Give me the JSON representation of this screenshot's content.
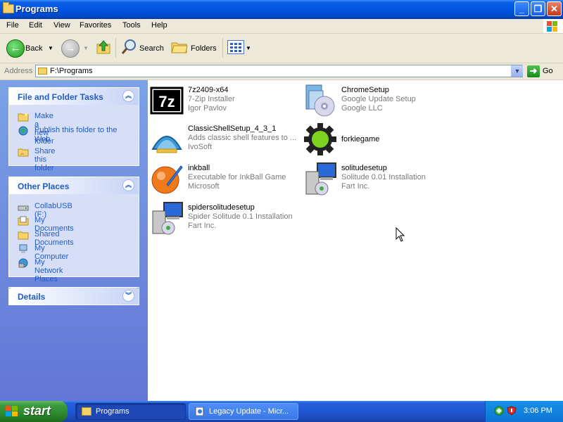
{
  "window": {
    "title": "Programs"
  },
  "menu": {
    "file": "File",
    "edit": "Edit",
    "view": "View",
    "favorites": "Favorites",
    "tools": "Tools",
    "help": "Help"
  },
  "toolbar": {
    "back": "Back",
    "search": "Search",
    "folders": "Folders"
  },
  "address": {
    "label": "Address",
    "value": "F:\\Programs",
    "go": "Go"
  },
  "left_pane": {
    "tasks": {
      "title": "File and Folder Tasks",
      "items": [
        {
          "label": "Make a new folder",
          "icon": "new-folder-icon"
        },
        {
          "label": "Publish this folder to the Web",
          "icon": "publish-web-icon"
        },
        {
          "label": "Share this folder",
          "icon": "share-folder-icon"
        }
      ]
    },
    "other_places": {
      "title": "Other Places",
      "items": [
        {
          "label": "CollabUSB (F:)",
          "icon": "drive-icon"
        },
        {
          "label": "My Documents",
          "icon": "my-documents-icon"
        },
        {
          "label": "Shared Documents",
          "icon": "shared-documents-icon"
        },
        {
          "label": "My Computer",
          "icon": "my-computer-icon"
        },
        {
          "label": "My Network Places",
          "icon": "network-places-icon"
        }
      ]
    },
    "details": {
      "title": "Details"
    }
  },
  "files": [
    {
      "name": "7z2409-x64",
      "line2": "7-Zip Installer",
      "line3": "Igor Pavlov",
      "icon": "7zip-icon"
    },
    {
      "name": "ChromeSetup",
      "line2": "Google Update Setup",
      "line3": "Google LLC",
      "icon": "installer-cd-icon"
    },
    {
      "name": "ClassicShellSetup_4_3_1",
      "line2": "Adds classic shell features to ...",
      "line3": "IvoSoft",
      "icon": "classic-shell-icon"
    },
    {
      "name": "forkiegame",
      "line2": "",
      "line3": "",
      "icon": "green-gear-icon"
    },
    {
      "name": "inkball",
      "line2": "Executable for InkBall Game",
      "line3": "Microsoft",
      "icon": "inkball-icon"
    },
    {
      "name": "solitudesetup",
      "line2": "Solitude 0.01 Installation",
      "line3": "Fart Inc.",
      "icon": "setup-computer-icon"
    },
    {
      "name": "spidersolitudesetup",
      "line2": "Spider Solitude 0.1 Installation",
      "line3": "Fart Inc.",
      "icon": "setup-computer-icon"
    }
  ],
  "taskbar": {
    "start": "start",
    "buttons": [
      {
        "label": "Programs",
        "icon": "folder-icon",
        "active": true
      },
      {
        "label": "Legacy Update - Micr...",
        "icon": "ie-page-icon",
        "active": false
      }
    ],
    "clock": "3:06 PM"
  },
  "colors": {
    "title_bar": "#0054e3",
    "left_pane": "#7ba2e7",
    "panel_title": "#215dc6",
    "start_button": "#3c9b3c",
    "taskbar": "#245edb"
  }
}
